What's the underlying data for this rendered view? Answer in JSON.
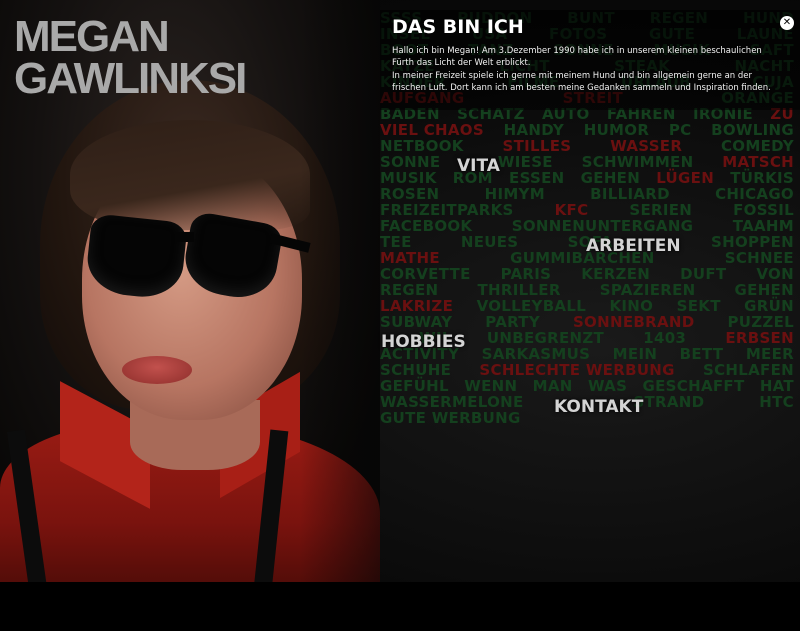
{
  "brand": {
    "line1": "MEGAN",
    "line2": "GAWLINKSI"
  },
  "intro": {
    "heading": "DAS BIN ICH",
    "paragraph1": "Hallo ich bin Megan! Am 3.Dezember 1990 habe ich in unserem kleinen beschaulichen Fürth das Licht der Welt erblickt.",
    "paragraph2": "In meiner Freizeit spiele ich gerne mit meinem Hund und bin allgemein gerne an der frischen Luft. Dort kann ich am besten meine Gedanken sammeln und Inspiration finden.",
    "close_symbol": "✕"
  },
  "nav": {
    "vita": "VITA",
    "arbeiten": "ARBEITEN",
    "hobbies": "HOBBIES",
    "kontakt": "KONTAKT"
  },
  "colors": {
    "cloud_green": "#14401e",
    "cloud_red": "#6a1010",
    "nav_text": "#d4d4d4",
    "brand_text": "#a9a9a9"
  },
  "word_cloud": [
    [
      [
        "SSSS",
        "g"
      ],
      [
        "PUDDON",
        "g"
      ],
      [
        "BUNT",
        "g"
      ],
      [
        "REGEN",
        "g"
      ],
      [
        "HUND",
        "g"
      ]
    ],
    [
      [
        "INSEL",
        "g"
      ],
      [
        "USA",
        "g"
      ],
      [
        "FOTOS",
        "g"
      ],
      [
        "GUTE",
        "g"
      ],
      [
        "LAUNE",
        "g"
      ]
    ],
    [
      [
        "BOOT",
        "g"
      ],
      [
        "TANZ",
        "g"
      ],
      [
        "SONNE",
        "g"
      ],
      [
        "MUSIK",
        "g"
      ],
      [
        "SAFT",
        "g"
      ]
    ],
    [
      [
        "KATZE",
        "g"
      ],
      [
        "LICHT",
        "g"
      ],
      [
        "STEAK",
        "g"
      ],
      [
        "NACHT",
        "g"
      ]
    ],
    [
      [
        "KINDER",
        "g"
      ],
      [
        "FILME",
        "g"
      ],
      [
        "URLAUB",
        "g"
      ],
      [
        "CUJA",
        "g"
      ]
    ],
    [
      [
        "AUFGANG",
        "r"
      ],
      [
        "STREIT",
        "r"
      ],
      [
        "ORANGE",
        "g"
      ]
    ],
    [
      [
        "BADEN",
        "g"
      ],
      [
        "SCHATZ",
        "g"
      ],
      [
        "AUTO",
        "g"
      ],
      [
        "FAHREN",
        "g"
      ],
      [
        "IRONIE",
        "g"
      ],
      [
        "ZU",
        "r"
      ]
    ],
    [
      [
        "VIEL CHAOS",
        "r"
      ],
      [
        "HANDY",
        "g"
      ],
      [
        "HUMOR",
        "g"
      ],
      [
        "PC",
        "g"
      ],
      [
        "BOWLING",
        "g"
      ]
    ],
    [
      [
        "NETBOOK",
        "g"
      ],
      [
        "STILLES",
        "r"
      ],
      [
        "WASSER",
        "r"
      ],
      [
        "COMEDY",
        "g"
      ]
    ],
    [
      [
        "SONNE",
        "g"
      ],
      [
        "",
        "g"
      ],
      [
        "WIESE",
        "g"
      ],
      [
        "SCHWIMMEN",
        "g"
      ],
      [
        "MATSCH",
        "r"
      ]
    ],
    [
      [
        "MUSIK",
        "g"
      ],
      [
        "ROM",
        "g"
      ],
      [
        "ESSEN",
        "g"
      ],
      [
        "GEHEN",
        "g"
      ],
      [
        "LÜGEN",
        "r"
      ],
      [
        "TÜRKIS",
        "g"
      ]
    ],
    [
      [
        "ROSEN",
        "g"
      ],
      [
        "HIMYM",
        "g"
      ],
      [
        "BILLIARD",
        "g"
      ],
      [
        "CHICAGO",
        "g"
      ]
    ],
    [
      [
        "FREIZEITPARKS",
        "g"
      ],
      [
        "KFC",
        "r"
      ],
      [
        "SERIEN",
        "g"
      ],
      [
        "FOSSIL",
        "g"
      ]
    ],
    [
      [
        "FACEBOOK",
        "g"
      ],
      [
        "SONNENUNTERGANG",
        "g"
      ],
      [
        "TAAHM",
        "g"
      ]
    ],
    [
      [
        "TEE",
        "g"
      ],
      [
        "NEUES",
        "g"
      ],
      [
        "SOFA",
        "g"
      ],
      [
        "",
        "g"
      ],
      [
        "SHOPPEN",
        "g"
      ]
    ],
    [
      [
        "MATHE",
        "r"
      ],
      [
        "GUMMIBÄRCHEN",
        "g"
      ],
      [
        "SCHNEE",
        "g"
      ]
    ],
    [
      [
        "CORVETTE",
        "g"
      ],
      [
        "PARIS",
        "g"
      ],
      [
        "KERZEN",
        "g"
      ],
      [
        "DUFT",
        "g"
      ],
      [
        "VON",
        "g"
      ]
    ],
    [
      [
        "REGEN",
        "g"
      ],
      [
        "THRILLER",
        "g"
      ],
      [
        "SPAZIEREN",
        "g"
      ],
      [
        "GEHEN",
        "g"
      ]
    ],
    [
      [
        "LAKRIZE",
        "r"
      ],
      [
        "VOLLEYBALL",
        "g"
      ],
      [
        "KINO",
        "g"
      ],
      [
        "SEKT",
        "g"
      ],
      [
        "GRÜN",
        "g"
      ]
    ],
    [
      [
        "SUBWAY",
        "g"
      ],
      [
        "PARTY",
        "g"
      ],
      [
        "SONNEBRAND",
        "r"
      ],
      [
        "PUZZEL",
        "g"
      ]
    ],
    [
      [
        "",
        "g"
      ],
      [
        "WII",
        "g"
      ],
      [
        "UNBEGRENZT",
        "g"
      ],
      [
        "1403",
        "g"
      ],
      [
        "ERBSEN",
        "r"
      ]
    ],
    [
      [
        "ACTIVITY",
        "g"
      ],
      [
        "SARKASMUS",
        "g"
      ],
      [
        "MEIN",
        "g"
      ],
      [
        "BETT",
        "g"
      ],
      [
        "MEER",
        "g"
      ]
    ],
    [
      [
        "SCHUHE",
        "g"
      ],
      [
        "SCHLECHTE WERBUNG",
        "r"
      ],
      [
        "SCHLAFEN",
        "g"
      ]
    ],
    [
      [
        "GEFÜHL",
        "g"
      ],
      [
        "WENN",
        "g"
      ],
      [
        "MAN",
        "g"
      ],
      [
        "WAS",
        "g"
      ],
      [
        "GESCHAFFT",
        "g"
      ],
      [
        "HAT",
        "g"
      ]
    ],
    [
      [
        "WASSERMELONE",
        "g"
      ],
      [
        "",
        "g"
      ],
      [
        "STRAND",
        "g"
      ],
      [
        "HTC",
        "g"
      ]
    ],
    [
      [
        "GUTE WERBUNG",
        "g"
      ]
    ]
  ]
}
